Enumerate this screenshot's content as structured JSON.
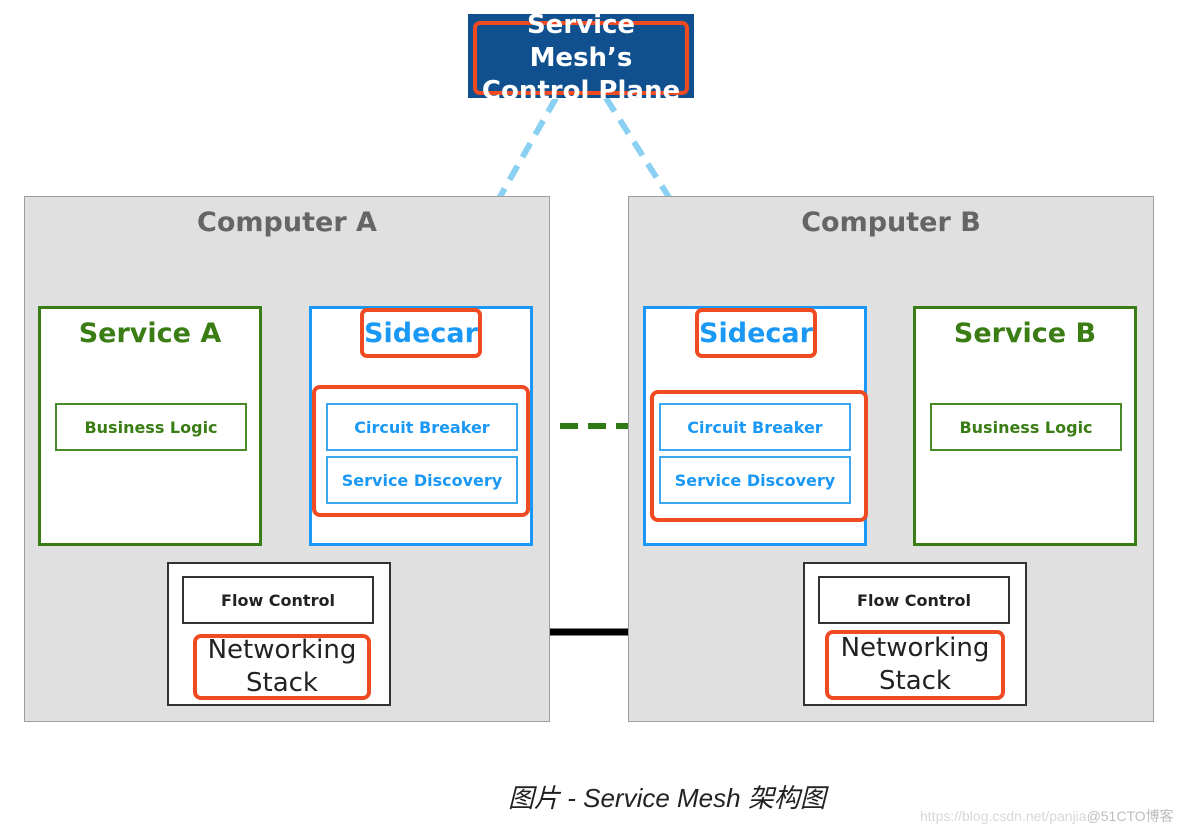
{
  "control_plane": {
    "title_line1": "Service Mesh’s",
    "title_line2": "Control Plane"
  },
  "computers": [
    {
      "title": "Computer A",
      "service": {
        "title": "Service A",
        "business_logic": "Business Logic"
      },
      "sidecar": {
        "title": "Sidecar",
        "components": [
          "Circuit Breaker",
          "Service Discovery"
        ]
      },
      "network": {
        "flow_control": "Flow Control",
        "title_line1": "Networking",
        "title_line2": "Stack"
      }
    },
    {
      "title": "Computer B",
      "service": {
        "title": "Service B",
        "business_logic": "Business Logic"
      },
      "sidecar": {
        "title": "Sidecar",
        "components": [
          "Circuit Breaker",
          "Service Discovery"
        ]
      },
      "network": {
        "flow_control": "Flow Control",
        "title_line1": "Networking",
        "title_line2": "Stack"
      }
    }
  ],
  "caption": "图片 - Service Mesh 架构图",
  "watermark": {
    "url": "https://blog.csdn.net/panjia",
    "brand": "@51CTO博客"
  },
  "colors": {
    "highlight": "#f04a23",
    "control_plane_bg": "#10508f",
    "service_green": "#3a7d15",
    "sidecar_blue": "#1a98f5",
    "control_link": "#8ad0f2"
  }
}
